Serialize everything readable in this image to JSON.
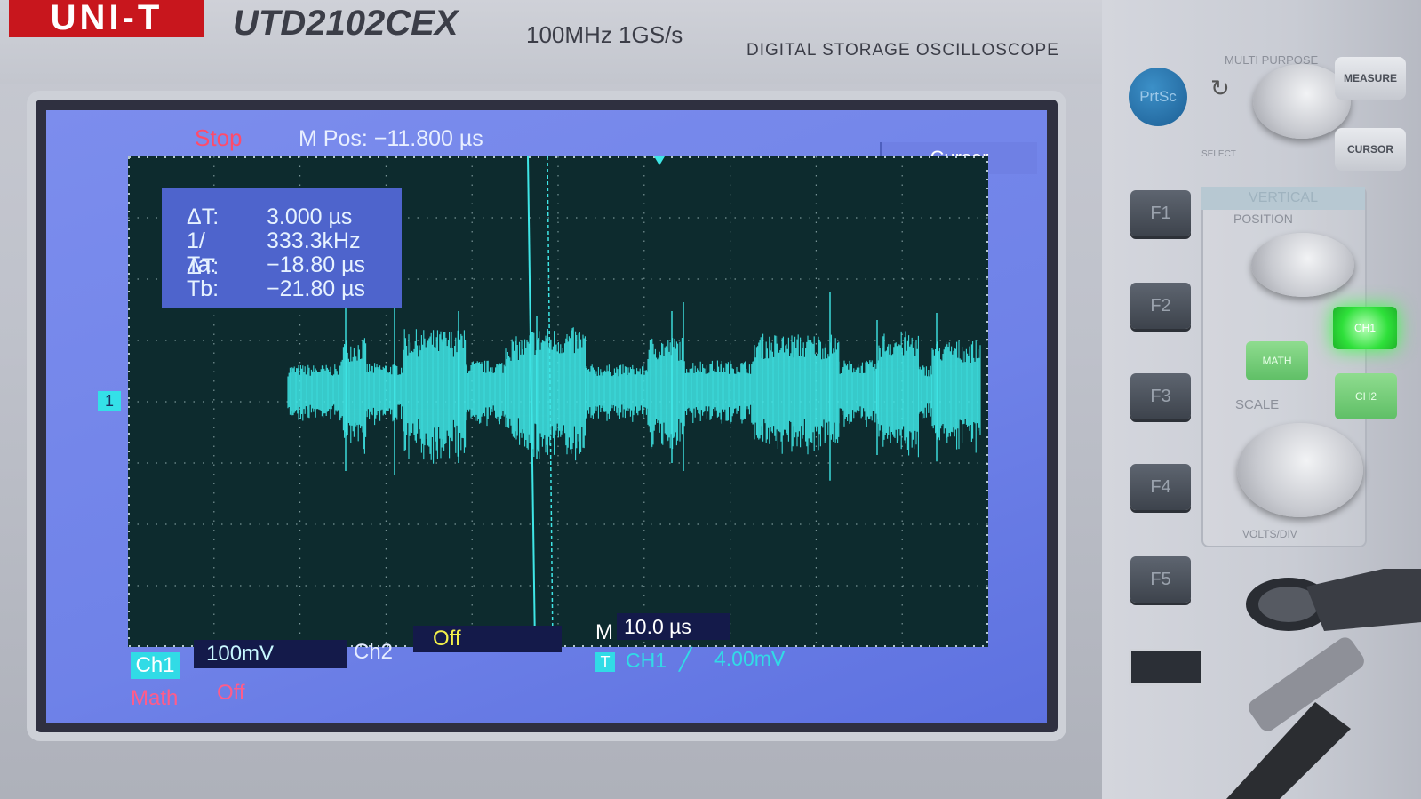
{
  "device": {
    "brand": "UNI-T",
    "model": "UTD2102CEX",
    "spec": "100MHz  1GS/s",
    "description": "DIGITAL STORAGE OSCILLOSCOPE"
  },
  "screen": {
    "status": "Stop",
    "m_pos": "M Pos: −11.800 µs",
    "menu_title": "Cursor",
    "cursor_readout": {
      "delta_t_label": "ΔT:",
      "delta_t_value": "3.000 µs",
      "inv_delta_t_label": "1/ΔT:",
      "inv_delta_t_value": "333.3kHz",
      "ta_label": "Ta:",
      "ta_value": "−18.80 µs",
      "tb_label": "Tb:",
      "tb_value": "−21.80 µs"
    },
    "channel_marker": "1",
    "bottom": {
      "ch1_label": "Ch1",
      "ch1_scale": "100mV",
      "ch2_label": "Ch2",
      "ch2_value": "Off",
      "math_label": "Math",
      "math_value": "Off",
      "timebase_label": "M",
      "timebase_value": "10.0 µs",
      "trigger_icon": "T",
      "trigger_source": "CH1",
      "trigger_edge": "╱",
      "trigger_level": "4.00mV"
    },
    "colors": {
      "screen_bg": "#7081e8",
      "plot_bg": "#0d2b2e",
      "trace": "#3fe6e6",
      "stop_text": "#ff4b6b",
      "math_text": "#ff5c8a",
      "ch2_value": "#f3f04a"
    }
  },
  "panel": {
    "prtsc_label": "PrtSc",
    "multi_purpose_label": "MULTI PURPOSE",
    "select_label": "SELECT",
    "measure_label": "MEASURE",
    "cursor_label": "CURSOR",
    "function_buttons": [
      "F1",
      "F2",
      "F3",
      "F4",
      "F5"
    ],
    "vertical_title": "VERTICAL",
    "position_label": "POSITION",
    "scale_label": "SCALE",
    "volts_div_label": "VOLTS/DIV",
    "ch1_button": "CH1",
    "math_button": "MATH",
    "ch2_button": "CH2"
  }
}
